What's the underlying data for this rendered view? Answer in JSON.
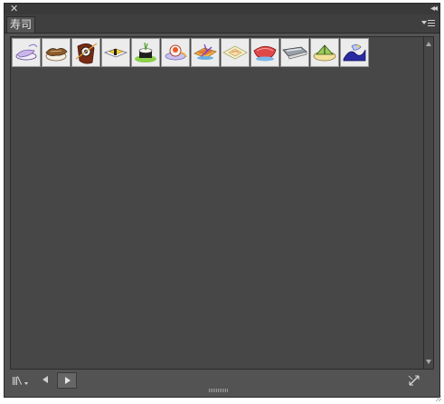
{
  "window": {
    "close_glyph": "✕",
    "collapse_glyph": "◂◂"
  },
  "panel": {
    "tab_label": "寿司",
    "menu_icon": "panel-menu-icon"
  },
  "symbols": [
    {
      "name": "symbol-1",
      "icon": "shrimp-sushi-icon"
    },
    {
      "name": "symbol-2",
      "icon": "eel-sushi-icon"
    },
    {
      "name": "symbol-3",
      "icon": "chopsticks-roll-icon"
    },
    {
      "name": "symbol-4",
      "icon": "egg-sushi-icon"
    },
    {
      "name": "symbol-5",
      "icon": "maki-roll-icon"
    },
    {
      "name": "symbol-6",
      "icon": "salmon-roe-icon"
    },
    {
      "name": "symbol-7",
      "icon": "fish-sushi-icon"
    },
    {
      "name": "symbol-8",
      "icon": "white-fish-sushi-icon"
    },
    {
      "name": "symbol-9",
      "icon": "tuna-sushi-icon"
    },
    {
      "name": "symbol-10",
      "icon": "mackerel-sushi-icon"
    },
    {
      "name": "symbol-11",
      "icon": "cucumber-sushi-icon"
    },
    {
      "name": "symbol-12",
      "icon": "wave-sushi-icon"
    }
  ],
  "bottom": {
    "library_icon": "symbol-libraries-menu-icon",
    "prev_icon": "previous-library-icon",
    "next_icon": "next-library-icon",
    "break_link_icon": "break-link-icon"
  },
  "colors": {
    "panel_bg": "#535353",
    "content_bg": "#474747",
    "tab_text": "#e3e3e3"
  }
}
